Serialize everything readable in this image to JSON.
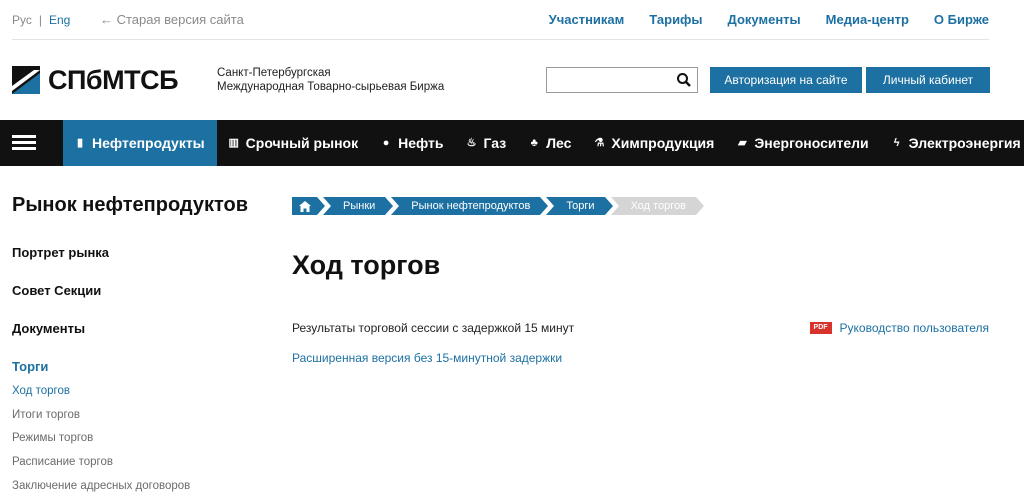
{
  "topbar": {
    "lang_ru": "Рус",
    "lang_sep": "|",
    "lang_en": "Eng",
    "old_version": "← Старая версия сайта",
    "nav": [
      "Участникам",
      "Тарифы",
      "Документы",
      "Медиа-центр",
      "О Бирже"
    ]
  },
  "header": {
    "logo_text": "СПбМТСБ",
    "org_line1": "Санкт-Петербургская",
    "org_line2": "Международная Товарно-сырьевая Биржа",
    "search_value": "",
    "search_icon": "search-icon",
    "auth_button": "Авторизация на сайте",
    "cabinet_button": "Личный кабинет"
  },
  "mainnav": {
    "menu_icon": "menu-icon",
    "items": [
      {
        "label": "Нефтепродукты",
        "icon": "document-icon",
        "glyph": "▮",
        "active": true
      },
      {
        "label": "Срочный рынок",
        "icon": "chart-icon",
        "glyph": "▥",
        "active": false
      },
      {
        "label": "Нефть",
        "icon": "drop-icon",
        "glyph": "●",
        "active": false
      },
      {
        "label": "Газ",
        "icon": "flame-icon",
        "glyph": "♨",
        "active": false
      },
      {
        "label": "Лес",
        "icon": "tree-icon",
        "glyph": "♣",
        "active": false
      },
      {
        "label": "Химпродукция",
        "icon": "flask-icon",
        "glyph": "⚗",
        "active": false
      },
      {
        "label": "Энергоносители",
        "icon": "canister-icon",
        "glyph": "▰",
        "active": false
      },
      {
        "label": "Электроэнергия",
        "icon": "lightning-icon",
        "glyph": "ϟ",
        "active": false
      }
    ]
  },
  "sidebar": {
    "title": "Рынок нефтепродуктов",
    "links": [
      "Портрет рынка",
      "Совет Секции",
      "Документы",
      "Торги"
    ],
    "sub_links": [
      "Ход торгов",
      "Итоги торгов",
      "Режимы торгов",
      "Расписание торгов",
      "Заключение адресных договоров"
    ]
  },
  "breadcrumbs": {
    "home_icon": "home-icon",
    "items": [
      "Рынки",
      "Рынок нефтепродуктов",
      "Торги",
      "Ход торгов"
    ]
  },
  "content": {
    "title": "Ход торгов",
    "session_text": "Результаты торговой сессии с задержкой 15 минут",
    "extended_link": "Расширенная версия без 15-минутной задержки",
    "pdf_badge": "PDF",
    "guide_link": "Руководство пользователя"
  },
  "colors": {
    "accent": "#1d70a2",
    "nav_bg": "#111111",
    "pdf_red": "#d9312b",
    "crumb_inactive": "#d5d5d5"
  }
}
